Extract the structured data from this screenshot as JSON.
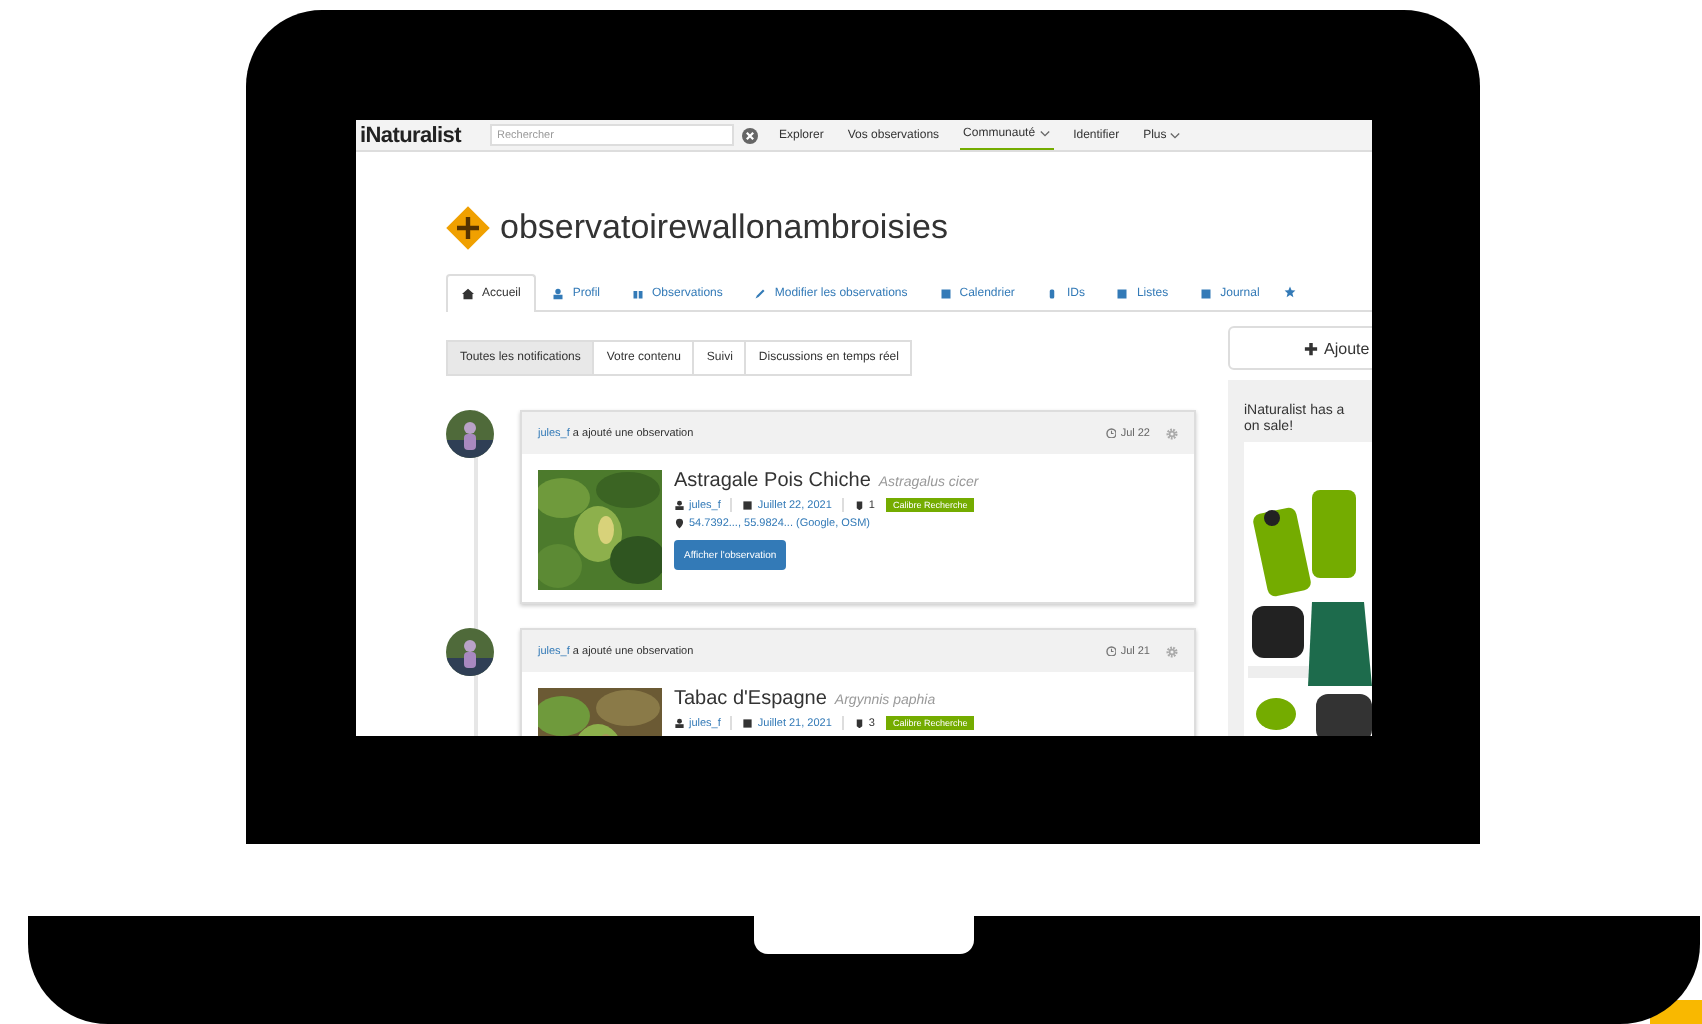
{
  "nav": {
    "logo": "iNaturalist",
    "search": {
      "placeholder": "Rechercher"
    },
    "items": [
      {
        "label": "Explorer",
        "selected": false,
        "dropdown": false
      },
      {
        "label": "Vos observations",
        "selected": false,
        "dropdown": false
      },
      {
        "label": "Communauté",
        "selected": true,
        "dropdown": true
      },
      {
        "label": "Identifier",
        "selected": false,
        "dropdown": false
      },
      {
        "label": "Plus",
        "selected": false,
        "dropdown": true
      }
    ]
  },
  "profile": {
    "name": "observatoirewallonambroisies"
  },
  "tabs": [
    {
      "label": "Accueil",
      "selected": true
    },
    {
      "label": "Profil",
      "selected": false
    },
    {
      "label": "Observations",
      "selected": false
    },
    {
      "label": "Modifier les observations",
      "selected": false
    },
    {
      "label": "Calendrier",
      "selected": false
    },
    {
      "label": "IDs",
      "selected": false
    },
    {
      "label": "Listes",
      "selected": false
    },
    {
      "label": "Journal",
      "selected": false
    }
  ],
  "filters": [
    {
      "label": "Toutes les notifications",
      "selected": true
    },
    {
      "label": "Votre contenu",
      "selected": false
    },
    {
      "label": "Suivi",
      "selected": false
    },
    {
      "label": "Discussions en temps réel",
      "selected": false
    }
  ],
  "feed": [
    {
      "user": "jules_f",
      "action": "a ajouté une observation",
      "time": "Jul 22",
      "title": "Astragale Pois Chiche",
      "scientific_name": "Astragalus cicer",
      "observer": "jules_f",
      "date": "Juillet 22, 2021",
      "comments": "1",
      "grade": "Calibre Recherche",
      "location": "54.7392..., 55.9824... (Google, OSM)",
      "button": "Afficher l'observation"
    },
    {
      "user": "jules_f",
      "action": "a ajouté une observation",
      "time": "Jul 21",
      "title": "Tabac d'Espagne",
      "scientific_name": "Argynnis paphia",
      "observer": "jules_f",
      "date": "Juillet 21, 2021",
      "comments": "3",
      "grade": "Calibre Recherche"
    }
  ],
  "sidebar": {
    "add_button": "Ajoute",
    "promo": [
      "iNaturalist has a",
      "on sale!"
    ]
  }
}
